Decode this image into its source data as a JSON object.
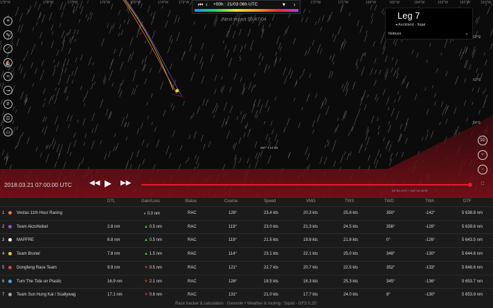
{
  "map": {
    "lon_labels": [
      "179°W",
      "178°W",
      "177°W",
      "176°W",
      "175°W",
      "174°W",
      "173°W",
      "172°W",
      "171°W",
      "166°W",
      "165°W",
      "164°W",
      "163°W",
      "162°W",
      "161°W"
    ],
    "lat_labels": [
      "52°S",
      "53°S",
      "54°S"
    ],
    "time_label": "+00h : 21/03 06h UTC",
    "next_report": "Next report 05:47:04",
    "wind_label": "297° • 14 kts",
    "coord_readout": "55°56.43'S • 162°18.38'W",
    "date": "2018.03.21 07:00:00 UTC",
    "progress": 0.998
  },
  "leg": {
    "title": "Leg 7",
    "route": "Auckland - Itajaí",
    "notices": "Notices"
  },
  "colors": {
    "accent": "#e0202a",
    "gain": "#3bd24a",
    "loss": "#e03030"
  },
  "table": {
    "headers": [
      "DTL",
      "Gain/Loss",
      "Status",
      "Course",
      "Speed",
      "VMG",
      "TWS",
      "TWD",
      "TWA",
      "DTF"
    ],
    "rows": [
      {
        "rank": "1",
        "color": "#f07a2a",
        "team": "Vestas 11th Hour Racing",
        "dtl": "",
        "trend": "neutral",
        "gain": "0.0 nm",
        "status": "RAC",
        "course": "126°",
        "speed": "23.4 kts",
        "vmg": "20.3 kts",
        "tws": "25.8 kts",
        "twd": "350°",
        "twa": "-142°",
        "dtf": "5 638.8 nm"
      },
      {
        "rank": "2",
        "color": "#8a5bd6",
        "team": "Team AkzoNobel",
        "dtl": "2.8 nm",
        "trend": "up",
        "gain": "0.5 nm",
        "status": "RAC",
        "course": "119°",
        "speed": "23.0 kts",
        "vmg": "21.3 kts",
        "tws": "24.5 kts",
        "twd": "356°",
        "twa": "-128°",
        "dtf": "5 639.6 nm"
      },
      {
        "rank": "3",
        "color": "#ffffff",
        "team": "MAPFRE",
        "dtl": "6.8 nm",
        "trend": "up",
        "gain": "0.5 nm",
        "status": "RAC",
        "course": "119°",
        "speed": "21.5 kts",
        "vmg": "19.8 kts",
        "tws": "21.8 kts",
        "twd": "0°",
        "twa": "-126°",
        "dtf": "5 643.5 nm"
      },
      {
        "rank": "4",
        "color": "#e8d12a",
        "team": "Team Brunel",
        "dtl": "7.8 nm",
        "trend": "up",
        "gain": "1.5 nm",
        "status": "RAC",
        "course": "114°",
        "speed": "23.1 kts",
        "vmg": "22.1 kts",
        "tws": "25.0 kts",
        "twd": "348°",
        "twa": "-130°",
        "dtf": "5 644.6 nm"
      },
      {
        "rank": "5",
        "color": "#e0403a",
        "team": "Dongfeng Race Team",
        "dtl": "9.9 nm",
        "trend": "down",
        "gain": "0.5 nm",
        "status": "RAC",
        "course": "121°",
        "speed": "22.7 kts",
        "vmg": "20.7 kts",
        "tws": "22.5 kts",
        "twd": "352°",
        "twa": "-133°",
        "dtf": "5 646.6 nm"
      },
      {
        "rank": "6",
        "color": "#4aa8e6",
        "team": "Turn The Tide on Plastic",
        "dtl": "16.9 nm",
        "trend": "down",
        "gain": "2.1 nm",
        "status": "RAC",
        "course": "126°",
        "speed": "18.5 kts",
        "vmg": "16.3 kts",
        "tws": "25.3 kts",
        "twd": "345°",
        "twa": "-136°",
        "dtf": "5 653.7 nm"
      },
      {
        "rank": "7",
        "color": "#aaaaaa",
        "team": "Team Sun Hung Kai / Scallywag",
        "dtl": "17.1 nm",
        "trend": "down",
        "gain": "0.6 nm",
        "status": "RAC",
        "course": "131°",
        "speed": "21.0 kts",
        "vmg": "17.7 kts",
        "tws": "24.0 kts",
        "twd": "8°",
        "twa": "-130°",
        "dtf": "5 653.9 nm"
      }
    ]
  },
  "footer": "Race tracker & calculation : Geovoile • Weather & routing : Squid - GFS 0.25°"
}
